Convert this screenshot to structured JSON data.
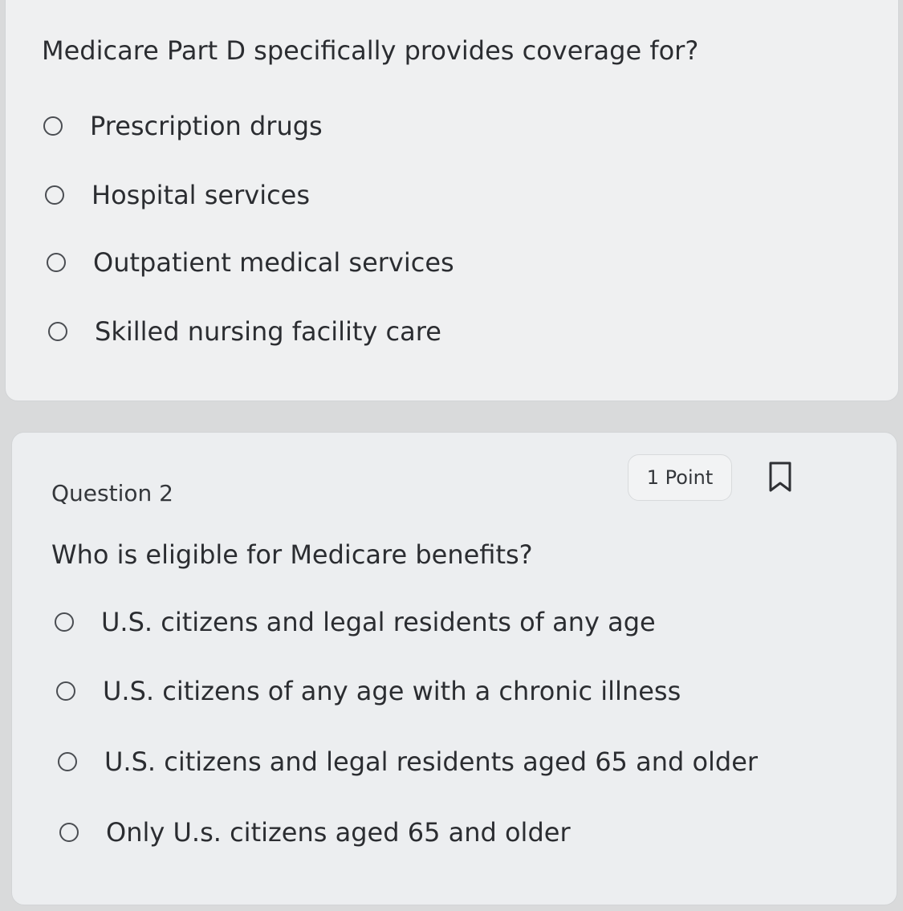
{
  "question1": {
    "prompt": "Medicare Part D specifically provides coverage for?",
    "options": [
      {
        "label": "Prescription drugs"
      },
      {
        "label": "Hospital services"
      },
      {
        "label": "Outpatient medical services"
      },
      {
        "label": "Skilled nursing facility care"
      }
    ]
  },
  "question2": {
    "number_label": "Question 2",
    "points_label": "1 Point",
    "prompt": "Who is eligible for Medicare benefits?",
    "options": [
      {
        "label": "U.S. citizens and legal residents of any age"
      },
      {
        "label": "U.S. citizens of any age with a chronic illness"
      },
      {
        "label": "U.S. citizens and legal residents aged 65 and older"
      },
      {
        "label": "Only U.s. citizens aged 65 and older"
      }
    ]
  },
  "icons": {
    "bookmark": "bookmark-icon",
    "radio": "radio-unselected-icon"
  }
}
